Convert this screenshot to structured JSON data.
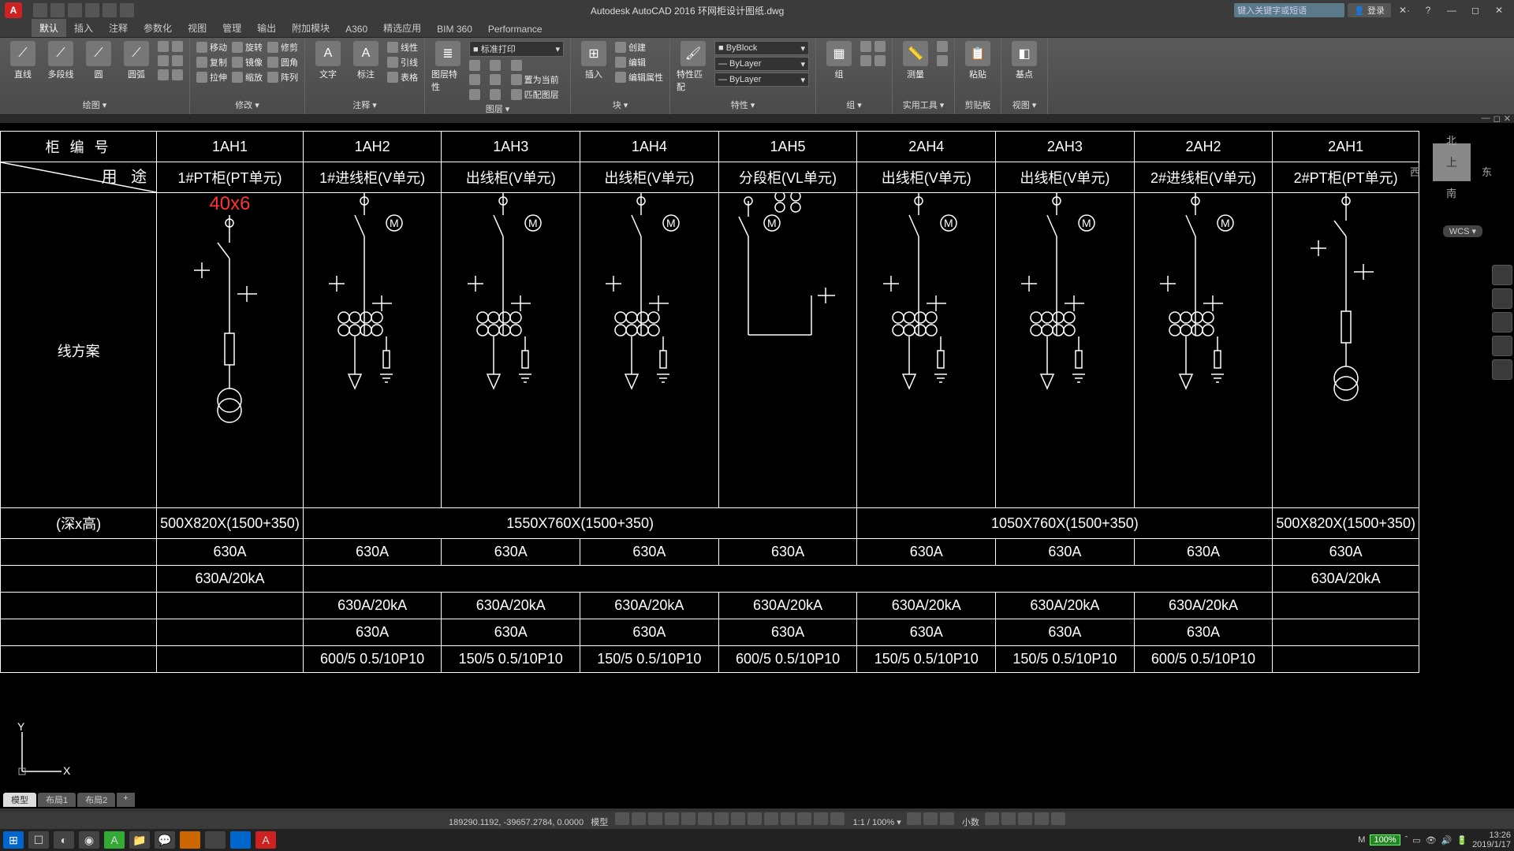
{
  "app": {
    "title": "Autodesk AutoCAD 2016    环网柜设计图纸.dwg",
    "search_placeholder": "键入关键字或短语",
    "login": "登录"
  },
  "tabs": [
    "默认",
    "插入",
    "注释",
    "参数化",
    "视图",
    "管理",
    "输出",
    "附加模块",
    "A360",
    "精选应用",
    "BIM 360",
    "Performance"
  ],
  "active_tab_index": 0,
  "panels": {
    "draw": {
      "title": "绘图 ▾",
      "big": [
        {
          "lbl": "直线"
        },
        {
          "lbl": "多段线"
        },
        {
          "lbl": "圆"
        },
        {
          "lbl": "圆弧"
        }
      ]
    },
    "modify": {
      "title": "修改 ▾",
      "rows": [
        [
          "移动",
          "旋转",
          "修剪"
        ],
        [
          "复制",
          "镜像",
          "圆角"
        ],
        [
          "拉伸",
          "缩放",
          "阵列"
        ]
      ]
    },
    "annot": {
      "title": "注释 ▾",
      "big": [
        {
          "lbl": "文字"
        },
        {
          "lbl": "标注"
        }
      ],
      "rows": [
        [
          "线性"
        ],
        [
          "引线"
        ],
        [
          "表格"
        ]
      ]
    },
    "layer": {
      "title": "图层 ▾",
      "big_lbl": "图层特性",
      "combo": "■ 标准打印",
      "rows": [
        [
          "",
          "",
          ""
        ],
        [
          "",
          "",
          "置为当前"
        ],
        [
          "",
          "",
          "匹配图层"
        ]
      ]
    },
    "block": {
      "title": "块 ▾",
      "big_lbl": "插入",
      "rows": [
        [
          "创建"
        ],
        [
          "编辑"
        ],
        [
          "编辑属性"
        ]
      ]
    },
    "props": {
      "title": "特性 ▾",
      "big_lbl": "特性匹配",
      "combos": [
        "ByBlock",
        "ByLayer",
        "ByLayer"
      ]
    },
    "group": {
      "title": "组 ▾",
      "lbl": "组"
    },
    "util": {
      "title": "实用工具 ▾",
      "lbl": "测量"
    },
    "clip": {
      "title": "剪贴板",
      "lbl": "粘贴"
    },
    "view": {
      "title": "视图 ▾",
      "lbl": "基点"
    }
  },
  "doc_controls": [
    "—",
    "◻",
    "✕"
  ],
  "drawing": {
    "row_labels": {
      "r1": "柜 编 号",
      "r2": "用    途",
      "r3": "线方案",
      "r4": "(深x高)"
    },
    "columns": [
      "1AH1",
      "1AH2",
      "1AH3",
      "1AH4",
      "1AH5",
      "2AH4",
      "2AH3",
      "2AH2",
      "2AH1"
    ],
    "usages": [
      "1#PT柜(PT单元)",
      "1#进线柜(V单元)",
      "出线柜(V单元)",
      "出线柜(V单元)",
      "分段柜(VL单元)",
      "出线柜(V单元)",
      "出线柜(V单元)",
      "2#进线柜(V单元)",
      "2#PT柜(PT单元)"
    ],
    "annotation": "40x6",
    "dims": {
      "d1": "500X820X(1500+350)",
      "d2": "1550X760X(1500+350)",
      "d3": "1050X760X(1500+350)",
      "d4": "500X820X(1500+350)"
    },
    "row_a": [
      "630A",
      "630A",
      "630A",
      "630A",
      "630A",
      "630A",
      "630A",
      "630A",
      "630A"
    ],
    "row_b_edges": "630A/20kA",
    "row_c": [
      "",
      "630A/20kA",
      "630A/20kA",
      "630A/20kA",
      "630A/20kA",
      "630A/20kA",
      "630A/20kA",
      "630A/20kA",
      ""
    ],
    "row_d": [
      "",
      "630A",
      "630A",
      "630A",
      "630A",
      "630A",
      "630A",
      "630A",
      ""
    ],
    "row_e": [
      "",
      "600/5 0.5/10P10",
      "150/5 0.5/10P10",
      "150/5 0.5/10P10",
      "600/5 0.5/10P10",
      "150/5 0.5/10P10",
      "150/5 0.5/10P10",
      "600/5 0.5/10P10",
      ""
    ]
  },
  "viewcube": {
    "n": "北",
    "s": "南",
    "e": "东",
    "w": "西",
    "top": "上",
    "wcs": "WCS ▾"
  },
  "layout_tabs": [
    "模型",
    "布局1",
    "布局2",
    "+"
  ],
  "status": {
    "coords": "189290.1192, -39657.2784, 0.0000",
    "space": "模型",
    "scale": "1:1 / 100% ▾",
    "decimals": "小数",
    "zoom": "100%"
  },
  "taskbar": {
    "time": "13:26",
    "date": "2019/1/17"
  }
}
